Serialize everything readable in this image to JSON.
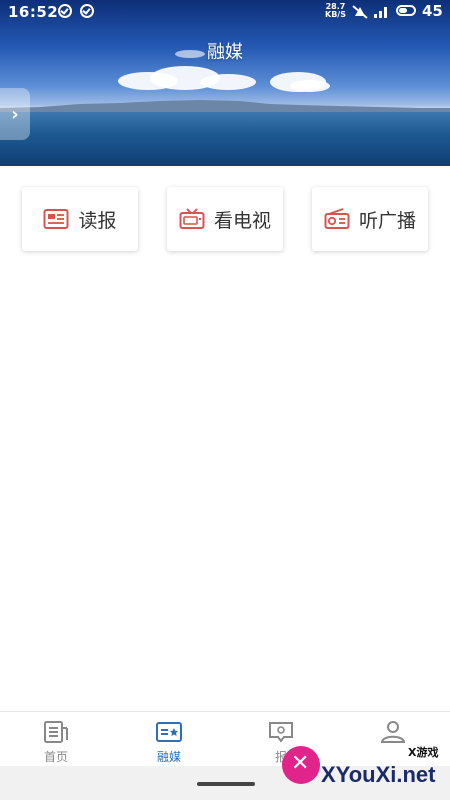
{
  "status_bar": {
    "time": "16:52",
    "net_speed_value": "28.7",
    "net_speed_unit": "KB/S",
    "battery_level": "45"
  },
  "header": {
    "title": "融媒"
  },
  "media_cards": [
    {
      "label": "读报",
      "icon": "newspaper-icon"
    },
    {
      "label": "看电视",
      "icon": "tv-icon"
    },
    {
      "label": "听广播",
      "icon": "radio-icon"
    }
  ],
  "bottom_nav": {
    "items": [
      {
        "label": "首页",
        "icon": "home-news-icon",
        "active": false
      },
      {
        "label": "融媒",
        "icon": "media-card-icon",
        "active": true
      },
      {
        "label": "报",
        "icon": "report-chat-icon",
        "active": false
      },
      {
        "label": "",
        "icon": "user-icon",
        "active": false
      }
    ]
  },
  "watermark": {
    "brand": "XYouXi.net",
    "tag": "X游戏"
  },
  "colors": {
    "accent": "#2a6fb8",
    "icon_red": "#d9534f",
    "text_dark": "#333333",
    "nav_gray": "#888888"
  }
}
